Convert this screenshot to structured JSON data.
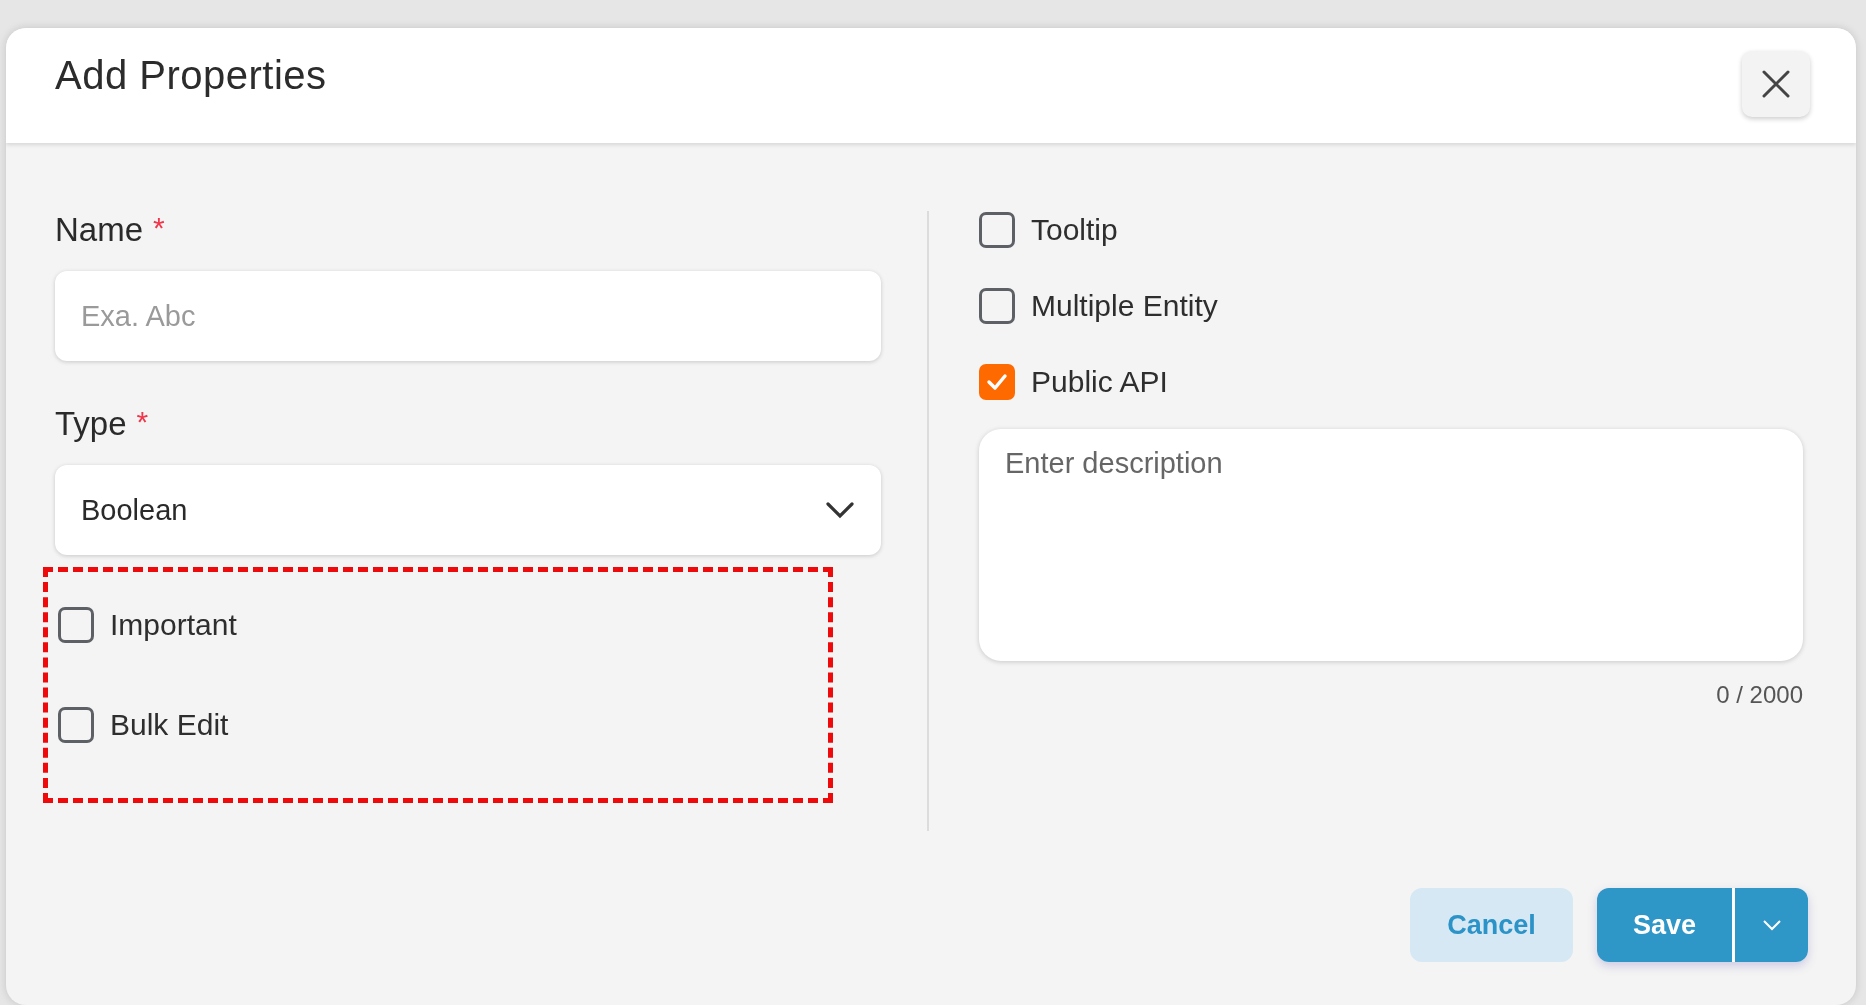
{
  "dialog": {
    "title": "Add Properties"
  },
  "fields": [
    {
      "kind": "text",
      "label": "Name",
      "required_mark": "*",
      "placeholder": "Exa. Abc"
    },
    {
      "kind": "select",
      "label": "Type",
      "required_mark": "*",
      "value": "Boolean"
    }
  ],
  "highlighted_options": [
    {
      "label": "Important",
      "checked": false
    },
    {
      "label": "Bulk Edit",
      "checked": false
    }
  ],
  "options": [
    {
      "label": "Tooltip",
      "checked": false
    },
    {
      "label": "Multiple Entity",
      "checked": false
    },
    {
      "label": "Public API",
      "checked": true
    }
  ],
  "description": {
    "placeholder": "Enter description",
    "counter": "0 / 2000"
  },
  "buttons": [
    {
      "kind": "secondary",
      "label": "Cancel"
    },
    {
      "kind": "split-primary",
      "label": "Save"
    }
  ]
}
